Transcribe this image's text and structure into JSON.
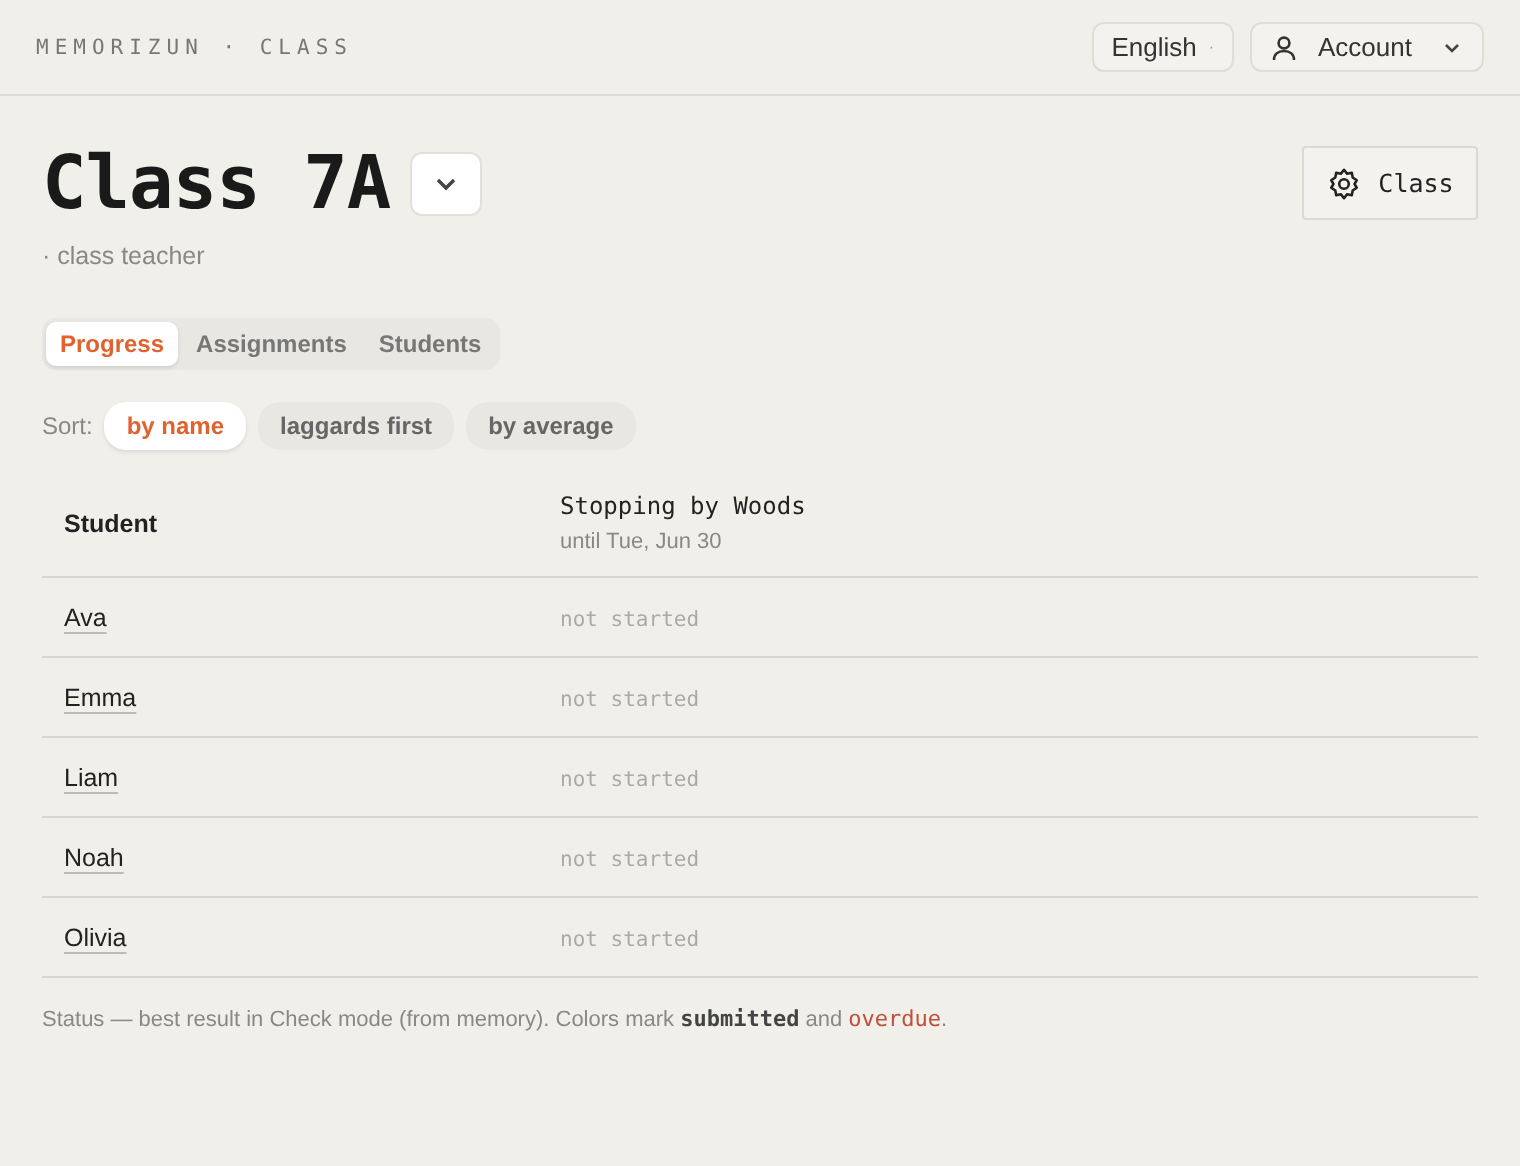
{
  "brand": "MEMORIZUN · CLASS",
  "language": {
    "label": "English",
    "caret": "·"
  },
  "account": {
    "label": "Account"
  },
  "title": "Class 7A",
  "settings_button": {
    "label": "Class"
  },
  "subtitle": "· class teacher",
  "tabs": [
    {
      "label": "Progress",
      "selected": true
    },
    {
      "label": "Assignments",
      "selected": false
    },
    {
      "label": "Students",
      "selected": false
    }
  ],
  "sort": {
    "label": "Sort:",
    "options": [
      {
        "label": "by name",
        "selected": true
      },
      {
        "label": "laggards first",
        "selected": false
      },
      {
        "label": "by average",
        "selected": false
      }
    ]
  },
  "table": {
    "columns": [
      {
        "label": "Student"
      },
      {
        "label": "Stopping by Woods",
        "due": "until Tue, Jun 30"
      }
    ],
    "rows": [
      {
        "student": "Ava",
        "status": "not started"
      },
      {
        "student": "Emma",
        "status": "not started"
      },
      {
        "student": "Liam",
        "status": "not started"
      },
      {
        "student": "Noah",
        "status": "not started"
      },
      {
        "student": "Olivia",
        "status": "not started"
      }
    ]
  },
  "footnote": [
    {
      "kind": "plain",
      "text": "Status — best result in Check mode (from memory). Colors mark "
    },
    {
      "kind": "submitted",
      "text": "submitted"
    },
    {
      "kind": "plain",
      "text": " and "
    },
    {
      "kind": "overdue",
      "text": "overdue"
    },
    {
      "kind": "plain",
      "text": "."
    }
  ]
}
